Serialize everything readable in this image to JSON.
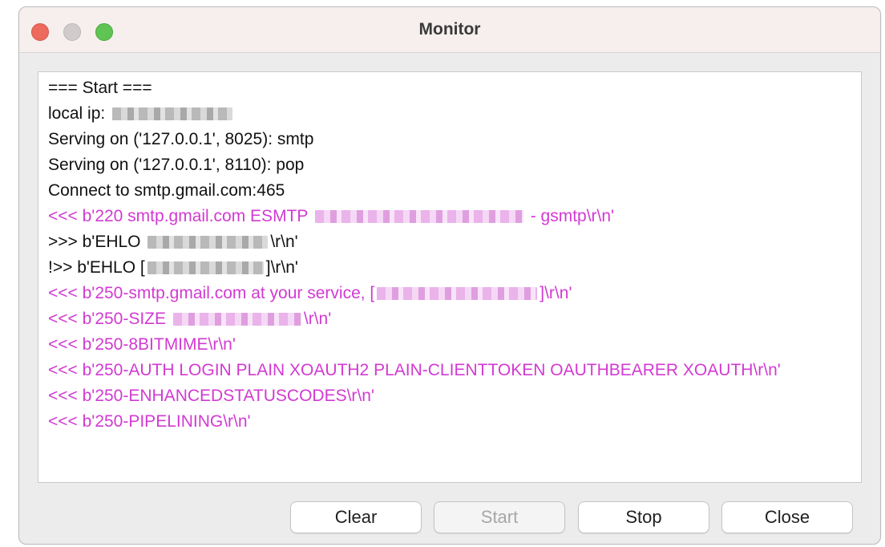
{
  "window": {
    "title": "Monitor"
  },
  "log": {
    "lines": [
      {
        "parts": [
          "=== Start ==="
        ],
        "type": "normal"
      },
      {
        "parts": [
          "local ip: ",
          "[redacted]"
        ],
        "type": "normal"
      },
      {
        "parts": [
          "Serving on ('127.0.0.1', 8025): smtp"
        ],
        "type": "normal"
      },
      {
        "parts": [
          "Serving on ('127.0.0.1', 8110): pop"
        ],
        "type": "normal"
      },
      {
        "parts": [
          "Connect to smtp.gmail.com:465"
        ],
        "type": "normal"
      },
      {
        "parts": [
          "<<< b'220 smtp.gmail.com ESMTP ",
          "[redacted]",
          " - gsmtp\\r\\n'"
        ],
        "type": "incoming"
      },
      {
        "parts": [
          ">>> b'EHLO ",
          "[redacted]",
          "\\r\\n'"
        ],
        "type": "normal"
      },
      {
        "parts": [
          "!>> b'EHLO [",
          "[redacted]",
          "]\\r\\n'"
        ],
        "type": "normal"
      },
      {
        "parts": [
          "<<< b'250-smtp.gmail.com at your service, [",
          "[redacted]",
          "]\\r\\n'"
        ],
        "type": "incoming"
      },
      {
        "parts": [
          "<<< b'250-SIZE ",
          "[redacted]",
          "\\r\\n'"
        ],
        "type": "incoming"
      },
      {
        "parts": [
          "<<< b'250-8BITMIME\\r\\n'"
        ],
        "type": "incoming"
      },
      {
        "parts": [
          "<<< b'250-AUTH LOGIN PLAIN XOAUTH2 PLAIN-CLIENTTOKEN OAUTHBEARER XOAUTH\\r\\n'"
        ],
        "type": "incoming"
      },
      {
        "parts": [
          "<<< b'250-ENHANCEDSTATUSCODES\\r\\n'"
        ],
        "type": "incoming"
      },
      {
        "parts": [
          "<<< b'250-PIPELINING\\r\\n'"
        ],
        "type": "incoming"
      }
    ]
  },
  "buttons": {
    "clear": "Clear",
    "start": "Start",
    "stop": "Stop",
    "close": "Close"
  },
  "colors": {
    "incoming_text": "#d23ad2",
    "normal_text": "#111111",
    "close_light": "#ed6a5e",
    "minimize_light": "#d0cccc",
    "zoom_light": "#5fc453"
  }
}
